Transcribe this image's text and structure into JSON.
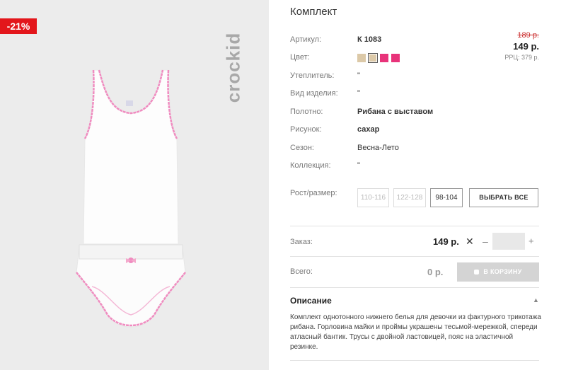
{
  "product": {
    "discount_badge": "-21%",
    "brand_watermark": "crockid",
    "title": "Комплект"
  },
  "specs": [
    {
      "label": "Артикул:",
      "value": "К 1083",
      "bold": true
    },
    {
      "label": "Цвет:",
      "value": ""
    },
    {
      "label": "Утеплитель:",
      "value": "\""
    },
    {
      "label": "Вид изделия:",
      "value": "\""
    },
    {
      "label": "Полотно:",
      "value": "Рибана с выставом",
      "bold": true
    },
    {
      "label": "Рисунок:",
      "value": "сахар",
      "bold": true
    },
    {
      "label": "Сезон:",
      "value": "Весна-Лето"
    },
    {
      "label": "Коллекция:",
      "value": "\""
    }
  ],
  "pricing": {
    "old_price": "189 р.",
    "price": "149 р.",
    "rrc": "РРЦ: 379 р."
  },
  "colors": [
    {
      "hex": "#dcc9a8",
      "selected": false
    },
    {
      "hex": "#dcc9a8",
      "selected": true
    },
    {
      "hex": "#e8337a",
      "selected": false
    },
    {
      "hex": "#e8337a",
      "selected": false
    }
  ],
  "sizes": {
    "label": "Рост/размер:",
    "options": [
      {
        "label": "110-116",
        "active": false
      },
      {
        "label": "122-128",
        "active": false
      },
      {
        "label": "98-104",
        "active": true
      }
    ],
    "select_all": "ВЫБРАТЬ ВСЕ"
  },
  "order": {
    "label": "Заказ:",
    "price": "149 р.",
    "times": "✕",
    "minus": "–",
    "plus": "+",
    "quantity": ""
  },
  "total": {
    "label": "Всего:",
    "value": "0 р.",
    "cart_button": "В КОРЗИНУ"
  },
  "description": {
    "title": "Описание",
    "text": "Комплект однотонного нижнего белья для девочки из фактурного трикотажа рибана. Горловина майки и проймы украшены тесьмой-мережкой, спереди атласный бантик. Трусы с двойной ластовицей, пояс на эластичной резинке."
  },
  "icons": {
    "caret": "caret-up-icon",
    "cart": "cart-icon"
  },
  "accent": {
    "badge_red": "#e3161b",
    "trim_pink": "#f08cc0"
  }
}
